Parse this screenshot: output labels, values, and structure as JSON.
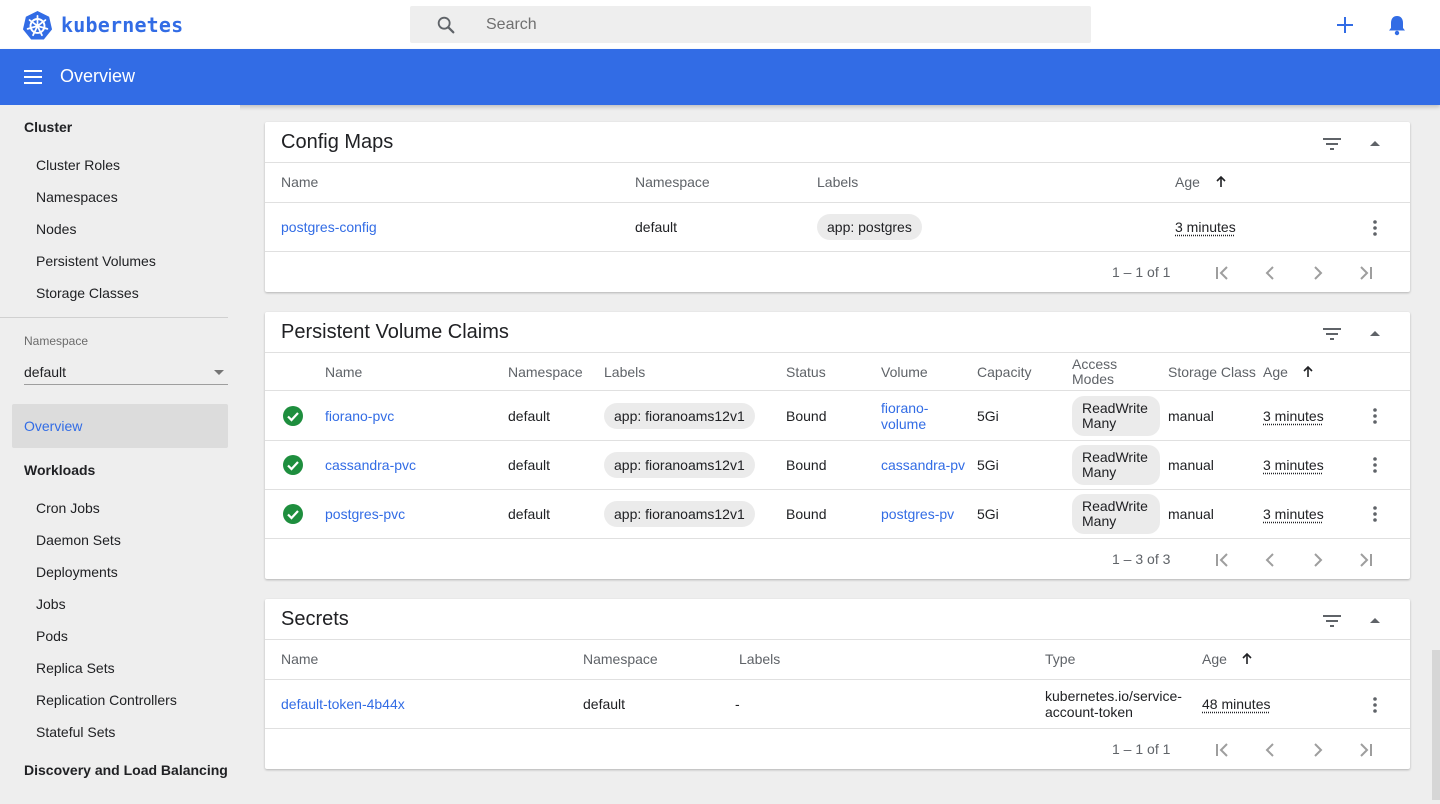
{
  "brand": {
    "name": "kubernetes",
    "color": "#326ce5"
  },
  "search": {
    "placeholder": "Search"
  },
  "header": {
    "title": "Overview"
  },
  "sidebar": {
    "cluster_title": "Cluster",
    "cluster_items": [
      "Cluster Roles",
      "Namespaces",
      "Nodes",
      "Persistent Volumes",
      "Storage Classes"
    ],
    "namespace_label": "Namespace",
    "namespace_value": "default",
    "active_item": "Overview",
    "workloads_title": "Workloads",
    "workload_items": [
      "Cron Jobs",
      "Daemon Sets",
      "Deployments",
      "Jobs",
      "Pods",
      "Replica Sets",
      "Replication Controllers",
      "Stateful Sets"
    ],
    "discovery_title": "Discovery and Load Balancing"
  },
  "config_maps": {
    "title": "Config Maps",
    "columns": {
      "name": "Name",
      "namespace": "Namespace",
      "labels": "Labels",
      "age": "Age"
    },
    "rows": [
      {
        "name": "postgres-config",
        "namespace": "default",
        "labels": "app: postgres",
        "age": "3 minutes"
      }
    ],
    "pagination": "1 – 1 of 1"
  },
  "pvc": {
    "title": "Persistent Volume Claims",
    "columns": {
      "name": "Name",
      "namespace": "Namespace",
      "labels": "Labels",
      "status": "Status",
      "volume": "Volume",
      "capacity": "Capacity",
      "access_modes_1": "Access",
      "access_modes_2": "Modes",
      "storage_class": "Storage Class",
      "age": "Age"
    },
    "rows": [
      {
        "name": "fiorano-pvc",
        "namespace": "default",
        "labels": "app: fioranoams12v1",
        "status": "Bound",
        "volume_1": "fiorano-",
        "volume_2": "volume",
        "capacity": "5Gi",
        "access_1": "ReadWrite",
        "access_2": "Many",
        "storage_class": "manual",
        "age": "3 minutes"
      },
      {
        "name": "cassandra-pvc",
        "namespace": "default",
        "labels": "app: fioranoams12v1",
        "status": "Bound",
        "volume_1": "cassandra-pv",
        "capacity": "5Gi",
        "access_1": "ReadWrite",
        "access_2": "Many",
        "storage_class": "manual",
        "age": "3 minutes"
      },
      {
        "name": "postgres-pvc",
        "namespace": "default",
        "labels": "app: fioranoams12v1",
        "status": "Bound",
        "volume_1": "postgres-pv",
        "capacity": "5Gi",
        "access_1": "ReadWrite",
        "access_2": "Many",
        "storage_class": "manual",
        "age": "3 minutes"
      }
    ],
    "pagination": "1 – 3 of 3"
  },
  "secrets": {
    "title": "Secrets",
    "columns": {
      "name": "Name",
      "namespace": "Namespace",
      "labels": "Labels",
      "type": "Type",
      "age": "Age"
    },
    "rows": [
      {
        "name": "default-token-4b44x",
        "namespace": "default",
        "labels": "-",
        "type_1": "kubernetes.io/service-",
        "type_2": "account-token",
        "age": "48 minutes"
      }
    ],
    "pagination": "1 – 1 of 1"
  },
  "colors": {
    "accent": "#326ce5",
    "success": "#1e8e3e",
    "text_secondary": "#5f6368"
  }
}
